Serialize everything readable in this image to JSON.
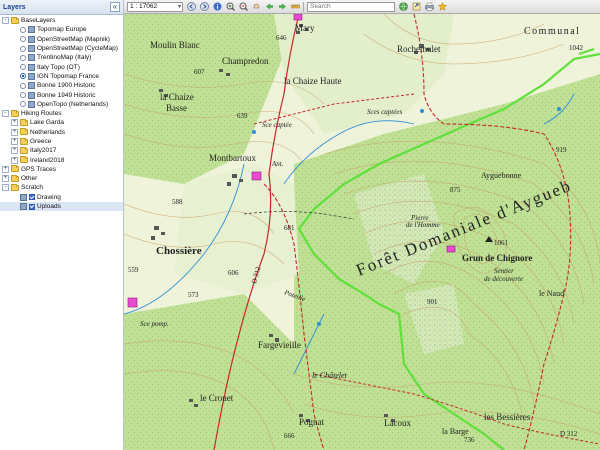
{
  "panel": {
    "title": "Layers",
    "collapse_label": "«",
    "tree": [
      {
        "label": "BaseLayers",
        "level": 0,
        "kind": "folder",
        "twisty": "-"
      },
      {
        "label": "Topomap Europe",
        "level": 1,
        "kind": "radio",
        "checked": false
      },
      {
        "label": "OpenStreetMap (Mapnik)",
        "level": 1,
        "kind": "radio",
        "checked": false
      },
      {
        "label": "OpenStreetMap (CycleMap)",
        "level": 1,
        "kind": "radio",
        "checked": false
      },
      {
        "label": "TrentinoMap (Italy)",
        "level": 1,
        "kind": "radio",
        "checked": false
      },
      {
        "label": "Italy Topo (OT)",
        "level": 1,
        "kind": "radio",
        "checked": false
      },
      {
        "label": "IGN Topomap France",
        "level": 1,
        "kind": "radio",
        "checked": true
      },
      {
        "label": "Bonne 1900 Historic",
        "level": 1,
        "kind": "radio",
        "checked": false
      },
      {
        "label": "Bonne 1949 Historic",
        "level": 1,
        "kind": "radio",
        "checked": false
      },
      {
        "label": "OpenTopo (Netherlands)",
        "level": 1,
        "kind": "radio",
        "checked": false
      },
      {
        "label": "Hiking Routes",
        "level": 0,
        "kind": "folder",
        "twisty": "-"
      },
      {
        "label": "Lake Garda",
        "level": 1,
        "kind": "folder",
        "twisty": "+"
      },
      {
        "label": "Netherlands",
        "level": 1,
        "kind": "folder",
        "twisty": "+"
      },
      {
        "label": "Greece",
        "level": 1,
        "kind": "folder",
        "twisty": "+"
      },
      {
        "label": "Italy2017",
        "level": 1,
        "kind": "folder",
        "twisty": "+"
      },
      {
        "label": "Ireland2018",
        "level": 1,
        "kind": "folder",
        "twisty": "+"
      },
      {
        "label": "GPS Traces",
        "level": 0,
        "kind": "folder",
        "twisty": "+"
      },
      {
        "label": "Other",
        "level": 0,
        "kind": "folder",
        "twisty": "+"
      },
      {
        "label": "Scratch",
        "level": 0,
        "kind": "folder",
        "twisty": "-"
      },
      {
        "label": "Drawing",
        "level": 1,
        "kind": "check",
        "checked": true
      },
      {
        "label": "Uploads",
        "level": 1,
        "kind": "check",
        "checked": true,
        "selected": true
      }
    ]
  },
  "toolbar": {
    "scale_value": "1 : 17062",
    "search_placeholder": "Search",
    "icons": [
      "prev-icon",
      "next-icon",
      "info-icon",
      "zoom-in-icon",
      "zoom-out-icon",
      "pan-icon",
      "back-icon",
      "forward-icon",
      "ruler-icon",
      "globe-icon",
      "export-icon",
      "print-icon",
      "bookmark-star-icon"
    ]
  },
  "map": {
    "colors": {
      "background": "#e9f0d0",
      "forest": "#b9dc8a",
      "contour": "#c9a36b",
      "road": "#c8282b",
      "water": "#2f8fd6",
      "boundary": "#5fe03a",
      "poi": "#e84ad2"
    },
    "labels": {
      "mary": "Mary",
      "rochemulet": "Rochemulet",
      "communal": "Communal",
      "moulin_blanc": "Moulin Blanc",
      "champredon": "Champredon",
      "la_chaize_haute": "la Chaize Haute",
      "la_chaize_basse_1": "la Chaize",
      "la_chaize_basse_2": "Basse",
      "sce_captee": "Sce captée",
      "sces_captees": "Sces captées",
      "montbartoux": "Montbartoux",
      "ant": "Ant.",
      "ayguebonne": "Ayguebonne",
      "foret": "Forêt Domaniale d'Aygueb",
      "pierre_1": "Pierre",
      "pierre_2": "de l'Homme",
      "grun": "Grun de Chignore",
      "sentier_1": "Sentier",
      "sentier_2": "de découverte",
      "chossiere": "Chossière",
      "le_naud": "le Naud",
      "fargevieille": "Fargevieille",
      "le_chatelet": "le Châtelet",
      "le_crouet": "le Crouet",
      "pognat": "Pognat",
      "lacoux": "Lacoux",
      "la_barge": "la Barge",
      "les_bessieres": "les Bessières",
      "sce_pompage": "Sce pomp.",
      "road_d312": "D 312",
      "road_d312b": "D 312",
      "poteille": "Poteille"
    },
    "spot_heights": {
      "h1042": "1042",
      "h646": "646",
      "h607": "607",
      "h639": "639",
      "h875": "875",
      "h919": "919",
      "h1061": "1061",
      "h681": "681",
      "h588": "588",
      "h606": "606",
      "h573": "573",
      "h559": "559",
      "h901": "901",
      "h666": "666",
      "h736": "736"
    }
  }
}
